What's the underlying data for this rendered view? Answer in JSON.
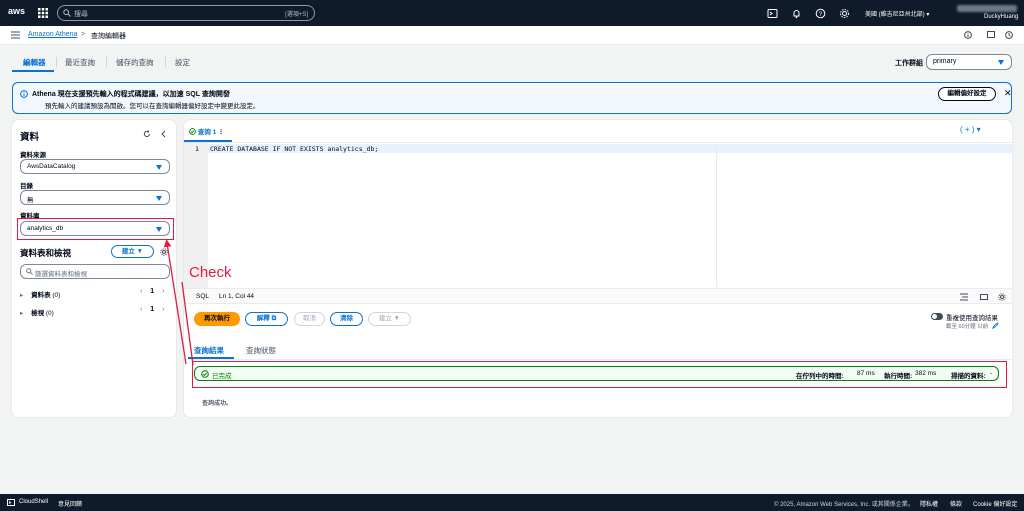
{
  "topbar": {
    "logo_text": "aws",
    "search_placeholder": "搜尋",
    "search_shortcut": "[選項+S]",
    "region": "美國 (維吉尼亞州北部) ▾",
    "account": "DuckyHuang"
  },
  "breadcrumb": {
    "service": "Amazon Athena",
    "separator": ">",
    "page": "查詢編輯器"
  },
  "tabs": [
    "編輯器",
    "最近查詢",
    "儲存的查詢",
    "設定"
  ],
  "workgroup": {
    "label": "工作群組",
    "value": "primary"
  },
  "flash": {
    "title": "Athena 現在支援預先輸入的程式碼建議，以加速 SQL 查詢開發",
    "body": "預先輸入的建議預設為開啟。您可以在查詢編輯器偏好設定中變更此設定。",
    "button": "編輯偏好設定",
    "close": "✕"
  },
  "data_panel": {
    "title": "資料",
    "source_label": "資料來源",
    "source_value": "AwsDataCatalog",
    "catalog_label": "目錄",
    "catalog_value": "無",
    "db_label": "資料庫",
    "db_value": "analytics_db",
    "tables_title": "資料表和檢視",
    "create_button": "建立 ▼",
    "filter_placeholder": "篩選資料表和檢視",
    "tables_row": "資料表",
    "tables_count": "(0)",
    "views_row": "檢視",
    "views_count": "(0)",
    "page": "1"
  },
  "editor": {
    "tab_label": "查詢 1",
    "line_no": "1",
    "code": "CREATE DATABASE IF NOT EXISTS analytics_db;",
    "lang": "SQL",
    "position": "Ln 1, Col 44",
    "add_tab": "+"
  },
  "actions": {
    "run_again": "再次執行",
    "explain": "解釋",
    "cancel": "取消",
    "clear": "清除",
    "create": "建立 ▼",
    "reuse": "重複使用查詢結果",
    "reuse_sub": "截至 60分鐘 以前"
  },
  "result_tabs": [
    "查詢結果",
    "查詢狀態"
  ],
  "result": {
    "status": "已完成",
    "queue_label": "在佇列中的時間:",
    "queue_value": "87 ms",
    "run_label": "執行時間:",
    "run_value": "382 ms",
    "scan_label": "掃描的資料:",
    "scan_value": "-",
    "message": "查詢成功。"
  },
  "annotation": {
    "text": "Check",
    "color": "#e31b3f"
  },
  "footer": {
    "cloudshell": "CloudShell",
    "feedback": "意見回饋",
    "copyright": "© 2025, Amazon Web Services, Inc. 或其關係企業。",
    "privacy": "隱私權",
    "terms": "條款",
    "cookie": "Cookie 偏好設定"
  },
  "colors": {
    "accent": "#0972d3",
    "topbar": "#0f1b2a",
    "primary_button": "#ff9900",
    "success": "#037f0c"
  }
}
